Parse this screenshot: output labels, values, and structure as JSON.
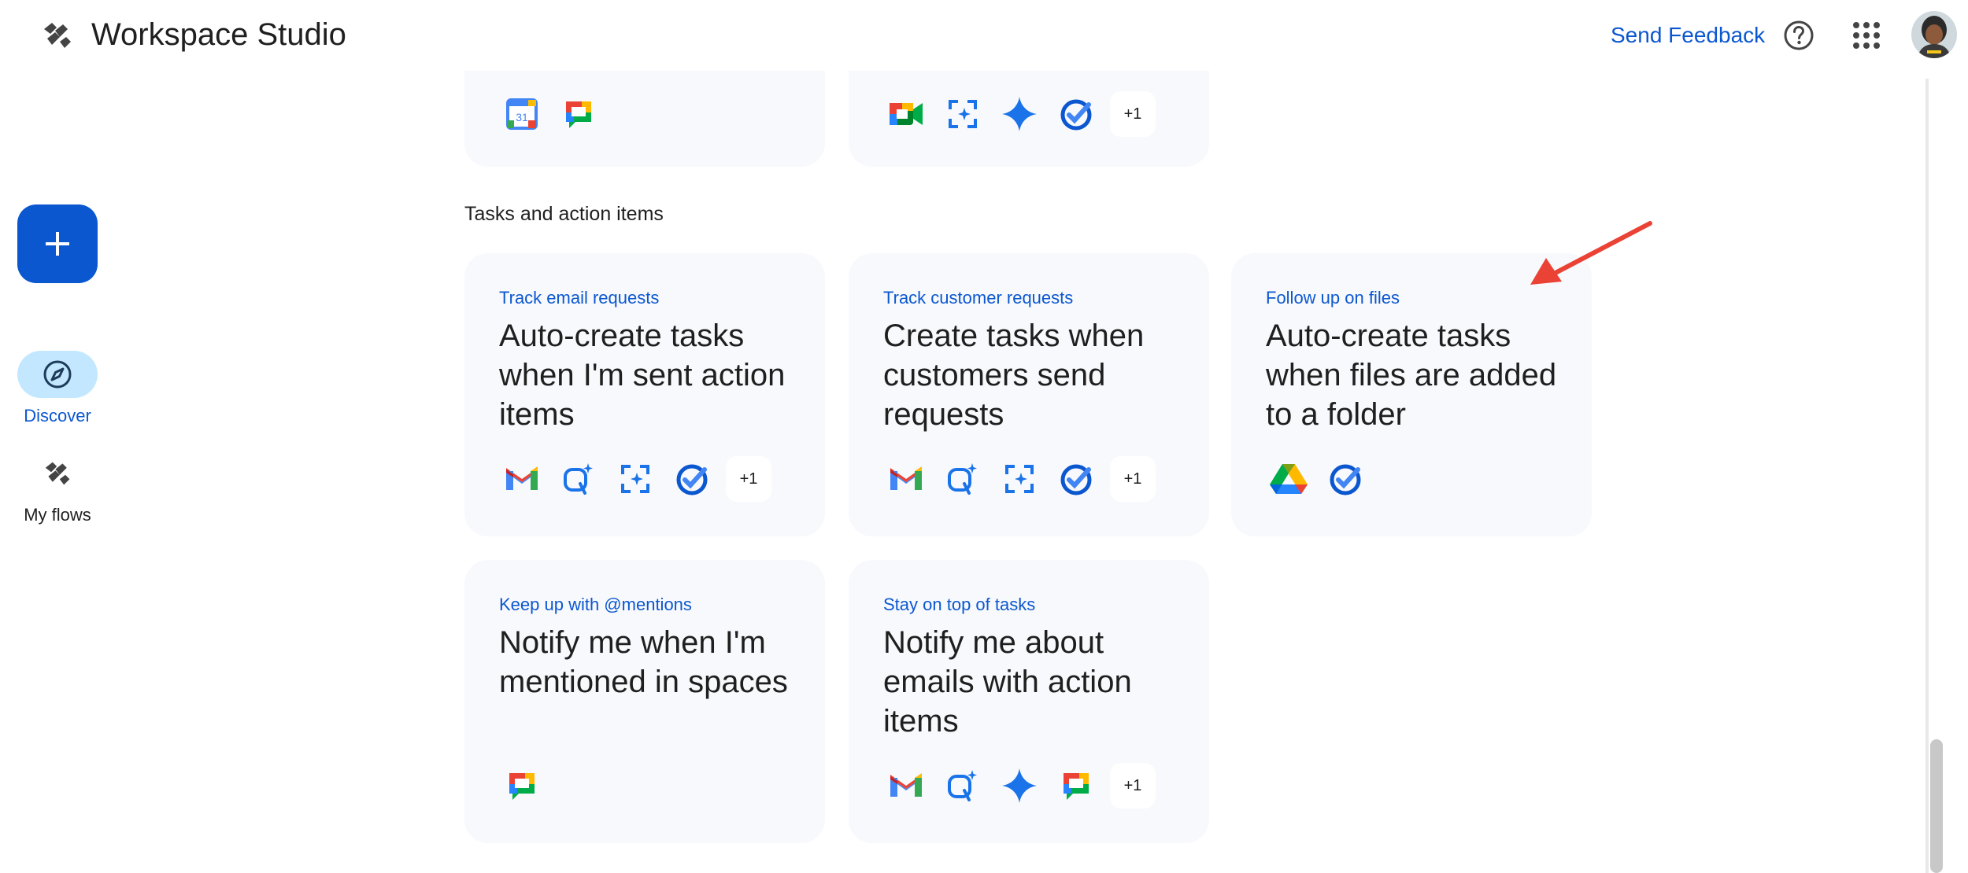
{
  "header": {
    "app_title": "Workspace Studio",
    "feedback_label": "Send Feedback",
    "help_icon": "help-icon",
    "apps_icon": "apps-grid-icon"
  },
  "rail": {
    "create_icon": "plus-icon",
    "discover_label": "Discover",
    "my_flows_label": "My flows"
  },
  "top_cards": [
    {
      "icons": [
        "calendar-icon",
        "chat-icon"
      ],
      "extra": ""
    },
    {
      "icons": [
        "meet-icon",
        "screen-ai-icon",
        "gemini-icon",
        "tasks-icon"
      ],
      "extra": "+1"
    }
  ],
  "section": {
    "title": "Tasks and action items"
  },
  "cards": [
    {
      "kicker": "Track email requests",
      "heading": "Auto-create tasks when I'm sent action items",
      "icons": [
        "gmail-icon",
        "search-ai-icon",
        "screen-ai-icon",
        "tasks-icon"
      ],
      "extra": "+1"
    },
    {
      "kicker": "Track customer requests",
      "heading": "Create tasks when customers send requests",
      "icons": [
        "gmail-icon",
        "search-ai-icon",
        "screen-ai-icon",
        "tasks-icon"
      ],
      "extra": "+1"
    },
    {
      "kicker": "Follow up on files",
      "heading": "Auto-create tasks when files are added to a folder",
      "icons": [
        "drive-icon",
        "tasks-icon"
      ],
      "extra": ""
    },
    {
      "kicker": "Keep up with @mentions",
      "heading": "Notify me when I'm mentioned in spaces",
      "icons": [
        "chat-icon"
      ],
      "extra": ""
    },
    {
      "kicker": "Stay on top of tasks",
      "heading": "Notify me about emails with action items",
      "icons": [
        "gmail-icon",
        "search-ai-icon",
        "gemini-icon",
        "chat-icon"
      ],
      "extra": "+1"
    }
  ],
  "colors": {
    "accent": "#0b57d0",
    "card_bg": "#f8f9fc",
    "arrow": "#ea4335"
  }
}
